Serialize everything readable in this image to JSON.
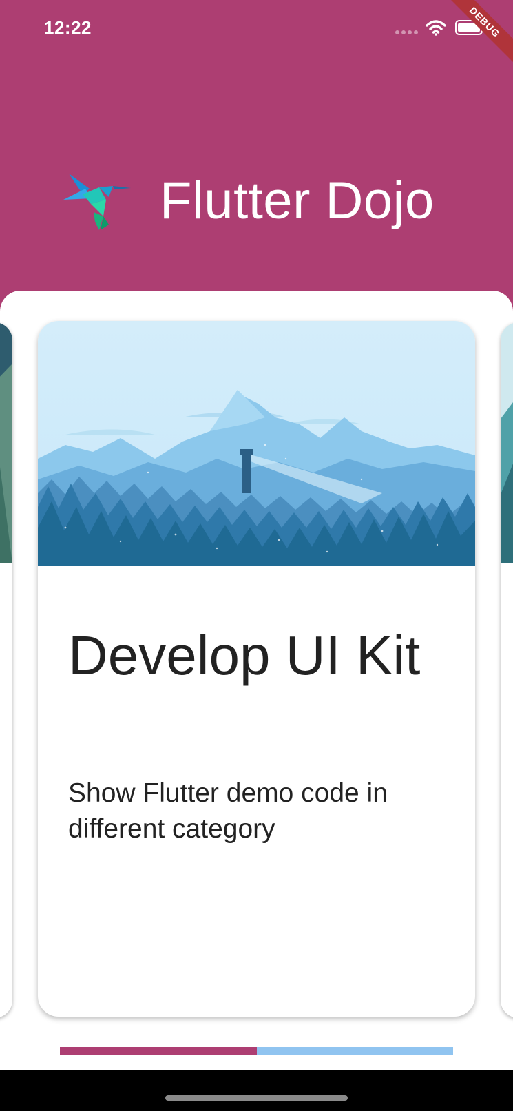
{
  "status_bar": {
    "time": "12:22",
    "debug_label": "DEBUG"
  },
  "header": {
    "app_title": "Flutter Dojo",
    "logo": "hummingbird-logo-icon"
  },
  "card": {
    "title": "Develop UI Kit",
    "subtitle": "Show Flutter demo code in different category",
    "image": "mountain-forest-lighthouse-illustration"
  },
  "pager": {
    "current_page": 1,
    "page_count": 2,
    "progress": 0.5
  },
  "colors": {
    "brand": "#ad3e72",
    "indicator_active": "#ad3e72",
    "indicator_inactive": "#90c4f0",
    "card_sky": "#d6eefa",
    "forest_dark": "#1f6a94"
  }
}
